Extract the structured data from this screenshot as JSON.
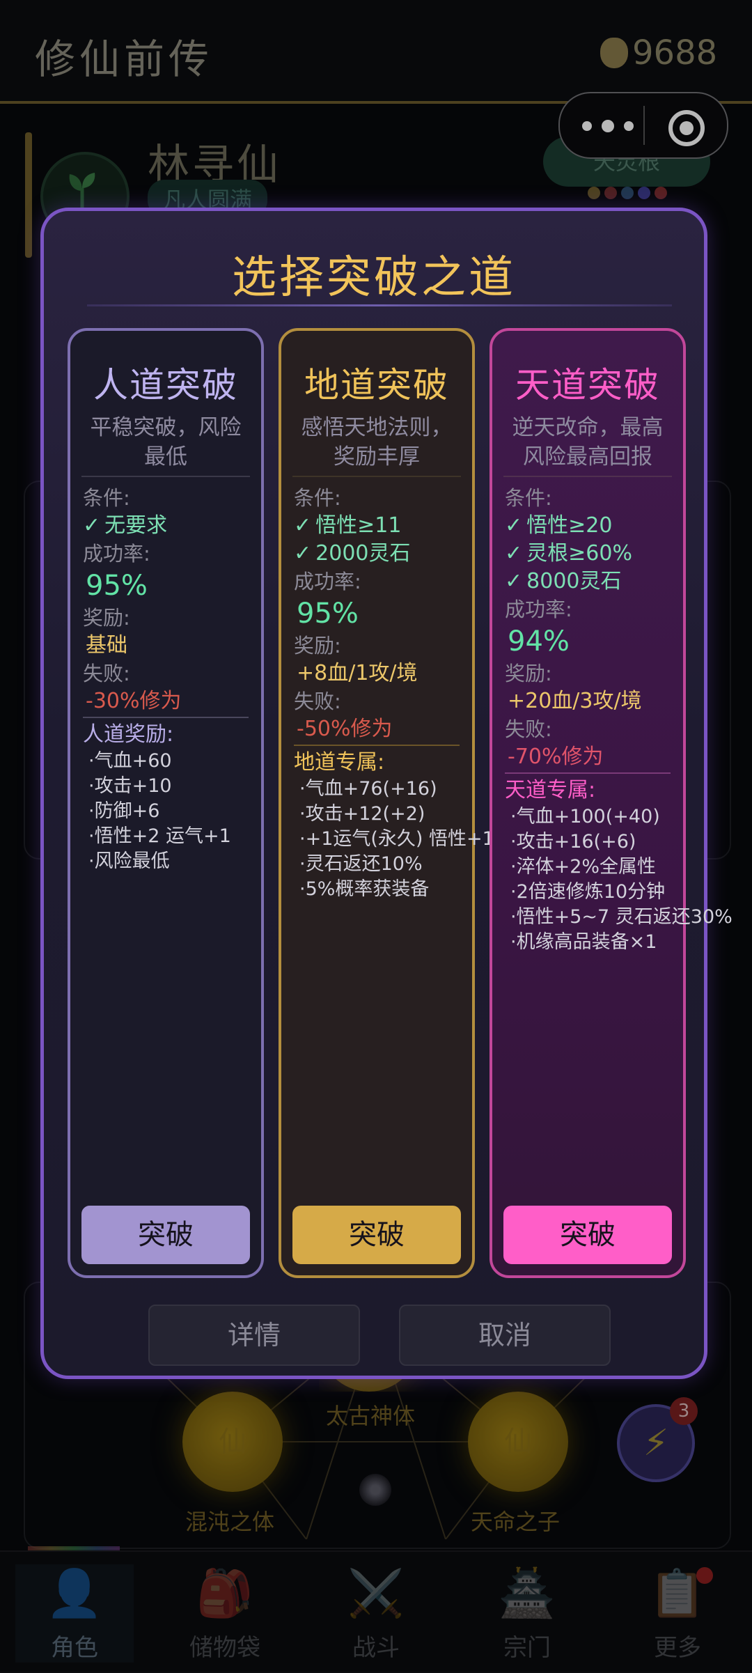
{
  "app": {
    "title": "修仙前传",
    "coins": "9688"
  },
  "character": {
    "name": "林寻仙",
    "realm": "凡人圆满",
    "root": "天灵根"
  },
  "root_colors": [
    "#6b5a2b",
    "#6b2b2b",
    "#2b4b6b",
    "#3b3b8b",
    "#7b2b2b"
  ],
  "constellation": {
    "nodes": [
      "太古神体",
      "混沌之体",
      "天命之子"
    ],
    "orb_glyph": "仙",
    "badge_count": "3"
  },
  "nav": [
    {
      "label": "角色",
      "icon": "👤"
    },
    {
      "label": "储物袋",
      "icon": "🎒"
    },
    {
      "label": "战斗",
      "icon": "⚔️"
    },
    {
      "label": "宗门",
      "icon": "🏯"
    },
    {
      "label": "更多",
      "icon": "📋"
    }
  ],
  "modal": {
    "title": "选择突破之道",
    "labels": {
      "conditions": "条件:",
      "success_rate": "成功率:",
      "reward": "奖励:",
      "failure": "失败:"
    },
    "check": "✓",
    "paths": [
      {
        "name": "人道突破",
        "desc_lines": [
          "平稳突破，风险",
          "最低"
        ],
        "conditions": [
          "无要求"
        ],
        "success_rate": "95%",
        "reward": "基础",
        "failure": "-30%修为",
        "bonus_title": "人道奖励:",
        "bonuses": [
          "·气血+60",
          "·攻击+10",
          "·防御+6",
          "·悟性+2 运气+1",
          "·风险最低"
        ],
        "button": "突破",
        "accent": "#a294d0"
      },
      {
        "name": "地道突破",
        "desc_lines": [
          "感悟天地法则，",
          "奖励丰厚"
        ],
        "conditions": [
          "悟性≥11",
          "2000灵石"
        ],
        "success_rate": "95%",
        "reward": "+8血/1攻/境",
        "failure": "-50%修为",
        "bonus_title": "地道专属:",
        "bonuses": [
          "·气血+76(+16)",
          "·攻击+12(+2)",
          "·+1运气(永久) 悟性+1",
          "·灵石返还10%",
          "·5%概率获装备"
        ],
        "button": "突破",
        "accent": "#f0c35a"
      },
      {
        "name": "天道突破",
        "desc_lines": [
          "逆天改命，最高",
          "风险最高回报"
        ],
        "conditions": [
          "悟性≥20",
          "灵根≥60%",
          "8000灵石"
        ],
        "success_rate": "94%",
        "reward": "+20血/3攻/境",
        "failure": "-70%修为",
        "bonus_title": "天道专属:",
        "bonuses": [
          "·气血+100(+40)",
          "·攻击+16(+6)",
          "·淬体+2%全属性",
          "·2倍速修炼10分钟",
          "·悟性+5~7 灵石返还30%",
          "·机缘高品装备×1"
        ],
        "button": "突破",
        "accent": "#ff5ec8"
      }
    ],
    "details_button": "详情",
    "cancel_button": "取消"
  }
}
